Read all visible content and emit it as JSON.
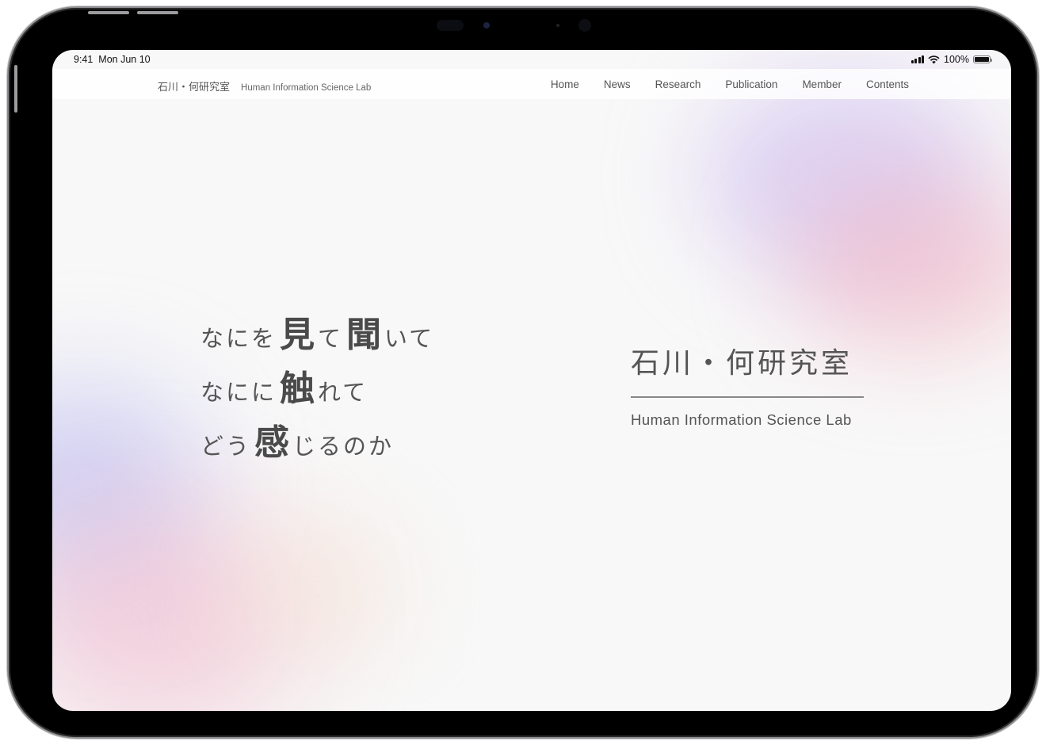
{
  "status_bar": {
    "time": "9:41",
    "date": "Mon Jun 10",
    "battery": "100%"
  },
  "header": {
    "brand_jp": "石川・何研究室",
    "brand_en": "Human Information Science Lab"
  },
  "nav": {
    "items": [
      {
        "label": "Home"
      },
      {
        "label": "News"
      },
      {
        "label": "Research"
      },
      {
        "label": "Publication"
      },
      {
        "label": "Member"
      },
      {
        "label": "Contents"
      }
    ]
  },
  "hero": {
    "line1": {
      "a": "なにを",
      "b": "見",
      "c": "て",
      "d": "聞",
      "e": "いて"
    },
    "line2": {
      "a": "なにに",
      "b": "触",
      "c": "れて"
    },
    "line3": {
      "a": "どう",
      "b": "感",
      "c": "じるのか"
    }
  },
  "title": {
    "jp": "石川・何研究室",
    "en": "Human Information Science Lab"
  },
  "colors": {
    "background": "#f8f8f8",
    "text": "#555555",
    "accent_purple": "#d8ccee",
    "accent_pink": "#f0c8d0",
    "accent_blue": "#c8c8f0"
  }
}
